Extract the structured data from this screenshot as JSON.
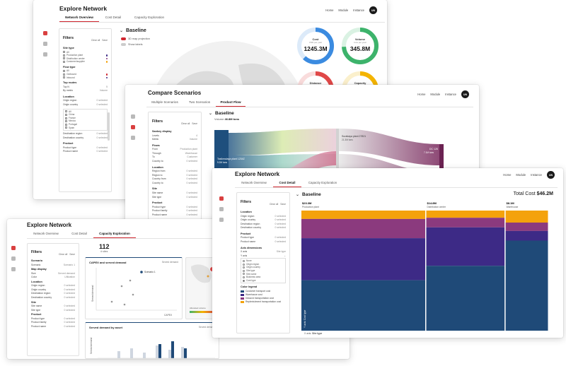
{
  "colors": {
    "accent_red": "#d0262f",
    "navy": "#1f4a78",
    "purple": "#3d2a86",
    "magenta": "#8b3a7e",
    "orange": "#f4a20c",
    "teal": "#2a9c9c",
    "green": "#3db36b",
    "blue": "#3b8be0"
  },
  "nav": {
    "home": "Home",
    "module": "Module",
    "instance": "Instance",
    "avatar": "UN"
  },
  "win1": {
    "title": "Explore Network",
    "tabs": [
      "Network Overview",
      "Cost Detail",
      "Capacity Exploration"
    ],
    "filters": {
      "title": "Filters",
      "clear": "Clear all",
      "save": "Save",
      "site_type": "Site type",
      "site_items": [
        "All",
        "Production plant",
        "Distribution center",
        "Customer/supplier"
      ],
      "flow_type": "Flow type",
      "flow_items": [
        "All",
        "Outbound",
        "Inbound"
      ],
      "top_routes": "Top routes",
      "top_n": "Top N",
      "top_n_value": "5",
      "by_metric": "By metric",
      "by_metric_value": "Volume",
      "location": "Location",
      "origin_region": "Origin region",
      "origin_country": "Origin country",
      "country_items": [
        "All",
        "China",
        "France",
        "Mexico",
        "Portugal",
        "Spain"
      ],
      "dest_region": "Destination region",
      "dest_country": "Destination country",
      "product": "Product",
      "product_type": "Product type",
      "product_name": "Product name",
      "selected": "0 selected"
    },
    "baseline": "Baseline",
    "toggle_projection": "3D map projection",
    "toggle_labels": "Show labels",
    "gauges": [
      {
        "label": "Cost",
        "sub": "USD per year",
        "value": "1245.3M",
        "color": "#3b8be0",
        "fraction": 0.62
      },
      {
        "label": "Volume",
        "sub": "tons per year",
        "value": "345.8M",
        "color": "#3db36b",
        "fraction": 0.74
      },
      {
        "label": "Distance",
        "sub": "miles",
        "value": "",
        "color": "#e04848",
        "fraction": 0.35
      },
      {
        "label": "Capacity",
        "sub": "units",
        "value": "",
        "color": "#f4b400",
        "fraction": 0.4
      }
    ]
  },
  "win2": {
    "title": "Compare Scenarios",
    "tabs": [
      "Multiple Scenarios",
      "Two Scenarios",
      "Product Flow"
    ],
    "filters": {
      "title": "Filters",
      "clear": "Clear all",
      "save": "Save",
      "sankey_display": "Sankey display",
      "levels": "Levels",
      "levels_value": "4",
      "metric": "Metric",
      "metric_value": "Volume",
      "flows": "Flows",
      "from": "From",
      "from_value": "Production plant",
      "through": "Through",
      "through_value": "Warehouse",
      "to": "To",
      "to_value": "Customer",
      "country_to": "Country to",
      "country_to_value": "0 selected",
      "location": "Location",
      "region_from": "Region from",
      "region_to": "Region to",
      "country_from": "Country from",
      "country_to2": "Country to",
      "site": "Site",
      "site_name": "Site name",
      "site_type": "Site type",
      "product": "Product",
      "product_type": "Product type",
      "product_family": "Product family",
      "product_name": "Product name",
      "selected": "0 selected"
    },
    "baseline": "Baseline",
    "volume_label": "Volume",
    "volume_value": "46.8M tons",
    "node_left": "Tasikmalaya plant 1234Z",
    "node_left_sub": "9.2M tons",
    "node_mid": "Surabaya plant 27821",
    "node_mid_sub": "21.3M tons",
    "node_right": "DC 128",
    "node_right_sub": "7.1M tons"
  },
  "win3": {
    "title": "Explore Network",
    "tabs": [
      "Network Overview",
      "Cost Detail",
      "Capacity Exploration"
    ],
    "filters": {
      "title": "Filters",
      "clear": "Clear all",
      "save": "Save",
      "scenario_section": "Scenario",
      "scenario": "Scenario",
      "scenario_value": "Scenario 1",
      "map_display": "Map display",
      "size": "Size",
      "size_value": "Served demand",
      "color": "Color",
      "color_value": "Utilization",
      "location": "Location",
      "origin_region": "Origin region",
      "origin_country": "Origin country",
      "dest_region": "Destination region",
      "dest_country": "Destination country",
      "site": "Site",
      "site_name": "Site name",
      "site_type": "Site type",
      "product": "Product",
      "product_type": "Product type",
      "product_family": "Product family",
      "product_name": "Product name",
      "selected": "0 selected"
    },
    "kpi_value": "112",
    "kpi_sub": "# sites",
    "capex_title": "CAPEX and served demand",
    "capex_dropdown": "Served demand",
    "capex_point_label": "Scenario 1",
    "capex_xlabel": "CAPEX",
    "capex_ylabel": "Served demand",
    "served_title": "Served demand by asset",
    "served_dropdown": "Served demand",
    "served_ylabel": "Served demand",
    "map_legend": "Allocated volume"
  },
  "win4": {
    "title": "Explore Network",
    "tabs": [
      "Network Overview",
      "Cost Detail",
      "Capacity Exploration"
    ],
    "filters": {
      "title": "Filters",
      "clear": "Clear all",
      "save": "Save",
      "location": "Location",
      "origin_region": "Origin region",
      "origin_country": "Origin country",
      "dest_region": "Destination region",
      "dest_country": "Destination country",
      "product": "Product",
      "product_type": "Product type",
      "product_name": "Product name",
      "axis_dimensions": "Axis dimensions",
      "x_axis": "X axis",
      "x_axis_value": "Site type",
      "y_axis": "Y axis",
      "y_items": [
        "None",
        "Origin region",
        "Origin country",
        "Site type",
        "Site name",
        "Business area",
        "Cost type"
      ],
      "color_legend": "Color legend",
      "legend_items": [
        {
          "label": "Customer transport cost",
          "color": "#1f4a78"
        },
        {
          "label": "Warehouse cost",
          "color": "#3d2a86"
        },
        {
          "label": "Inbound transportation cost",
          "color": "#8b3a7e"
        },
        {
          "label": "Replenishment transportation cost",
          "color": "#f4a20c"
        }
      ],
      "selected": "0 selected"
    },
    "baseline": "Baseline",
    "total_cost_label": "Total Cost",
    "total_cost_value": "$46.2M",
    "x_axis_caption": "X axis:",
    "x_axis_caption_value": "Site type",
    "y_axis_caption": "Y axis:",
    "y_axis_caption_value": "Cost type"
  },
  "chart_data": {
    "type": "bar",
    "title": "Baseline",
    "subtitle": "Total Cost $46.2M",
    "xlabel": "Site type",
    "ylabel": "Cost type",
    "categories": [
      "Production plant",
      "Distribution center",
      "Warehouse"
    ],
    "category_totals": [
      "$23.3M",
      "$14.8M",
      "$8.1M"
    ],
    "category_totals_m": [
      23.3,
      14.8,
      8.1
    ],
    "series": [
      {
        "name": "Replenishment transportation cost",
        "color": "#f4a20c",
        "values": [
          0.07,
          0.06,
          0.1
        ]
      },
      {
        "name": "Inbound transportation cost",
        "color": "#8b3a7e",
        "values": [
          0.16,
          0.08,
          0.07
        ]
      },
      {
        "name": "Warehouse cost",
        "color": "#3d2a86",
        "values": [
          0.35,
          0.32,
          0.08
        ]
      },
      {
        "name": "Customer transport cost",
        "color": "#1f4a78",
        "values": [
          0.42,
          0.54,
          0.75
        ]
      }
    ]
  }
}
